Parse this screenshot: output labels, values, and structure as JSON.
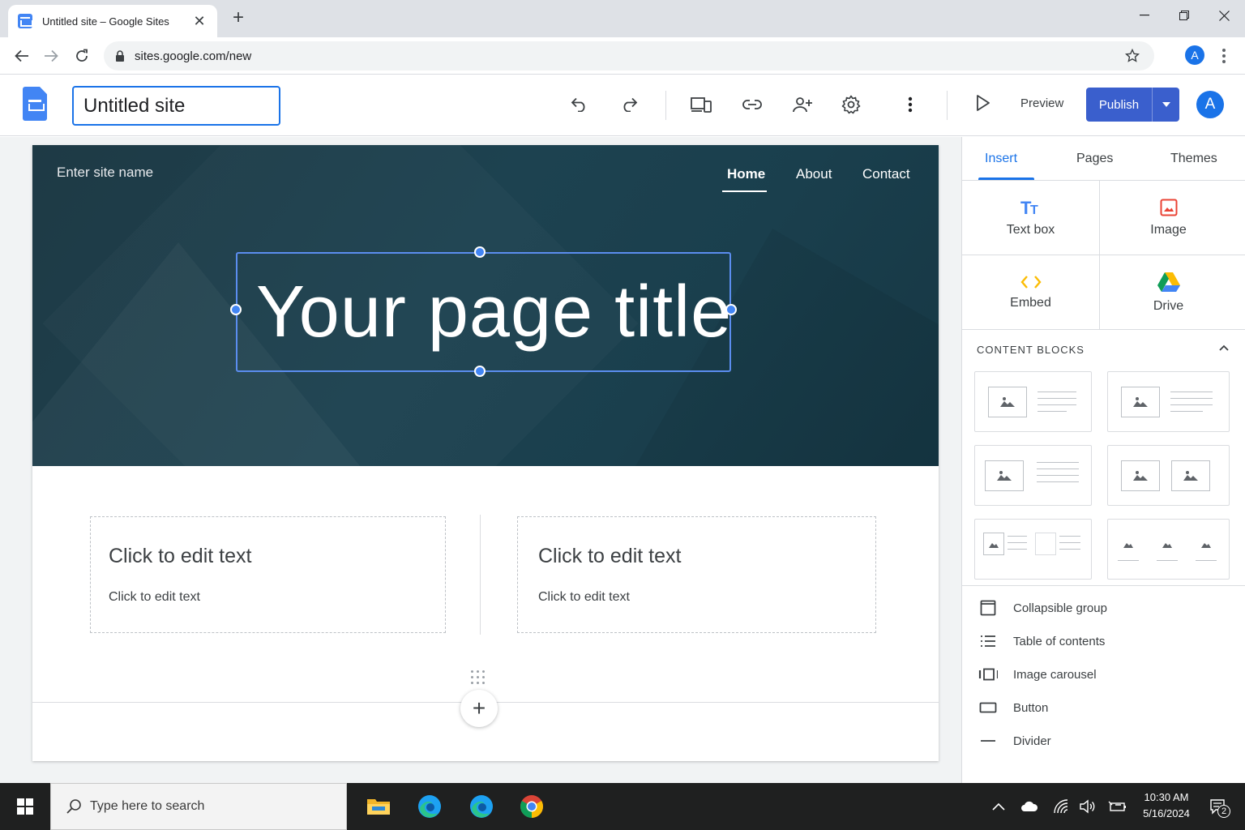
{
  "browser": {
    "tab_title": "Untitled site – Google Sites",
    "url": "sites.google.com/new",
    "profile_initial": "A"
  },
  "app": {
    "site_name_value": "Untitled site",
    "preview_label": "Preview",
    "publish_label": "Publish",
    "avatar_initial": "A",
    "accent_color": "#1a73e8",
    "publish_color": "#3a5fcd"
  },
  "page": {
    "site_name_placeholder": "Enter site name",
    "nav": [
      "Home",
      "About",
      "Contact"
    ],
    "active_nav": "Home",
    "title": "Your page title",
    "blocks": [
      {
        "heading": "Click to edit text",
        "body": "Click to edit text"
      },
      {
        "heading": "Click to edit text",
        "body": "Click to edit text"
      }
    ],
    "hero_color": "#1d4250"
  },
  "panel": {
    "tabs": [
      "Insert",
      "Pages",
      "Themes"
    ],
    "active_tab": "Insert",
    "insert_items": [
      {
        "label": "Text box",
        "icon": "text-box-icon"
      },
      {
        "label": "Image",
        "icon": "image-icon"
      },
      {
        "label": "Embed",
        "icon": "embed-icon"
      },
      {
        "label": "Drive",
        "icon": "drive-icon"
      }
    ],
    "content_blocks_title": "CONTENT BLOCKS",
    "list_items": [
      {
        "label": "Collapsible group",
        "icon": "collapsible-group-icon"
      },
      {
        "label": "Table of contents",
        "icon": "table-of-contents-icon"
      },
      {
        "label": "Image carousel",
        "icon": "image-carousel-icon"
      },
      {
        "label": "Button",
        "icon": "button-icon"
      },
      {
        "label": "Divider",
        "icon": "divider-icon"
      }
    ]
  },
  "taskbar": {
    "search_placeholder": "Type here to search",
    "time": "10:30 AM",
    "date": "5/16/2024",
    "notification_count": "2"
  }
}
